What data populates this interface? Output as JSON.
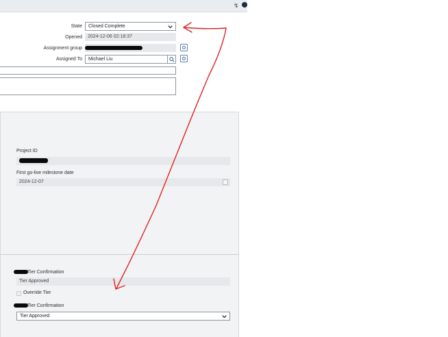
{
  "form": {
    "state": {
      "label": "State",
      "value": "Closed Complete"
    },
    "opened": {
      "label": "Opened",
      "value": "2024-12-06 02:18:37"
    },
    "assignment_group": {
      "label": "Assignment group"
    },
    "assigned_to": {
      "label": "Assigned To",
      "value": "Michael Liu"
    }
  },
  "project_section": {
    "project_id": {
      "label": "Project ID"
    },
    "milestone": {
      "label": "First go-live milestone date",
      "value": "2024-12-07"
    }
  },
  "tier_section": {
    "tier_confirmation_1": {
      "label": "Tier Confirmation",
      "value": "Tier Approved"
    },
    "override_tier": {
      "label": "Override Tier"
    },
    "tier_confirmation_2": {
      "label": "Tier Confirmation",
      "value": "Tier Approved"
    }
  },
  "icons": {
    "toolbar": [
      "pulse-icon",
      "help-icon"
    ],
    "lookup": "search-icon",
    "info": "info-icon",
    "calendar": "calendar-icon",
    "dropdown": "chevron-down-icon"
  },
  "colors": {
    "annotation_arrow": "#e02020",
    "panel_bg": "#f2f3f5",
    "readonly_bg": "#e6e8eb"
  }
}
